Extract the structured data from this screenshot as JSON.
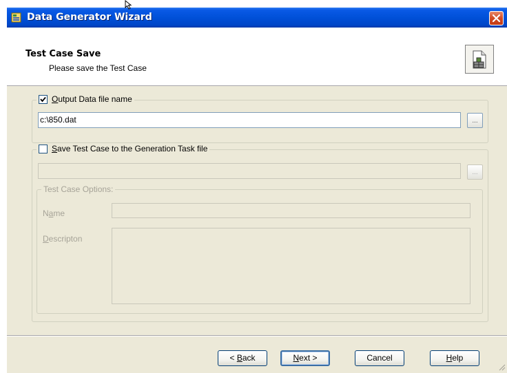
{
  "window": {
    "title": "Data Generator Wizard"
  },
  "header": {
    "title": "Test Case Save",
    "subtitle": "Please save the Test Case"
  },
  "output_group": {
    "checkbox_checked": true,
    "label_mnemonic": "O",
    "label_rest": "utput Data file name",
    "file_value": "c:\\850.dat",
    "browse_label": "..."
  },
  "save_group": {
    "checkbox_checked": false,
    "label_mnemonic": "S",
    "label_rest": "ave Test Case to the Generation Task file",
    "file_value": "",
    "browse_label": "...",
    "options": {
      "title": "Test Case Options:",
      "name_label_pre": "N",
      "name_label_mnemonic": "a",
      "name_label_post": "me",
      "name_value": "",
      "desc_label_mnemonic": "D",
      "desc_label_rest": "escripton",
      "desc_value": ""
    }
  },
  "buttons": {
    "back_pre": "< ",
    "back_mnemonic": "B",
    "back_rest": "ack",
    "next_mnemonic": "N",
    "next_rest": "ext >",
    "cancel": "Cancel",
    "help_mnemonic": "H",
    "help_rest": "elp"
  },
  "colors": {
    "titlebar": "#0050d8",
    "dialog_bg": "#ece9d8",
    "close_button": "#d24b25"
  }
}
